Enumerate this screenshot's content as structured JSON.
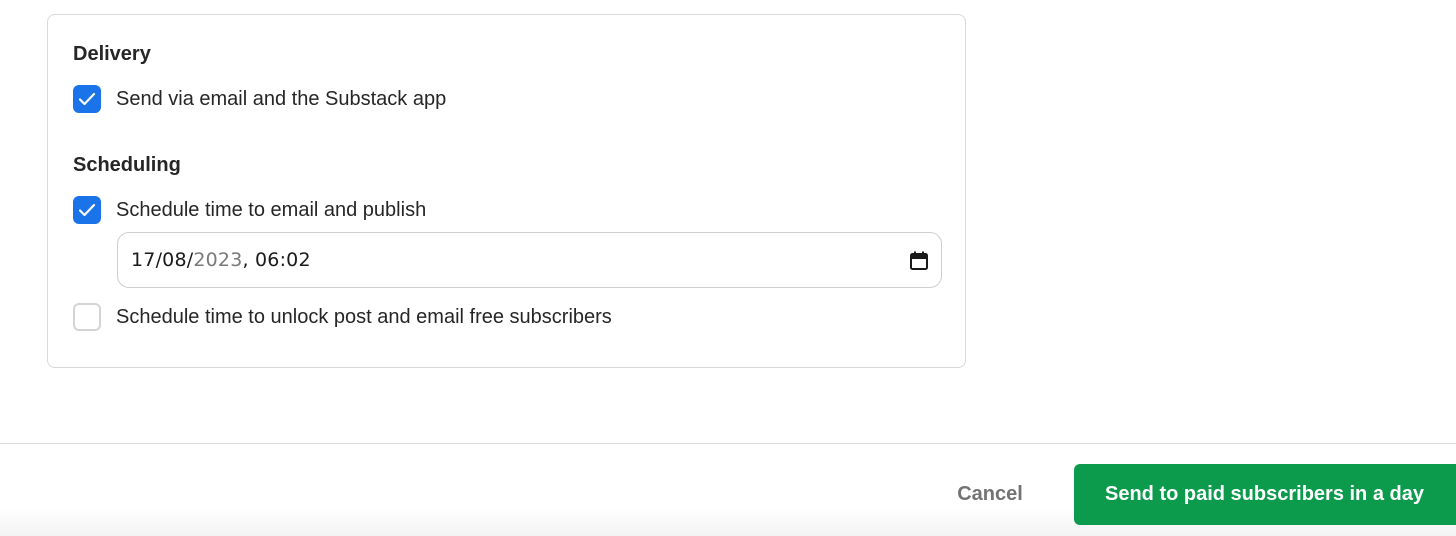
{
  "delivery": {
    "title": "Delivery",
    "options": [
      {
        "label": "Send via email and the Substack app",
        "checked": true
      }
    ]
  },
  "scheduling": {
    "title": "Scheduling",
    "schedule_publish": {
      "label": "Schedule time to email and publish",
      "checked": true
    },
    "datetime": {
      "day_month": "17/08/",
      "year": "2023",
      "time": ", 06:02"
    },
    "schedule_unlock": {
      "label": "Schedule time to unlock post and email free subscribers",
      "checked": false
    }
  },
  "footer": {
    "cancel_label": "Cancel",
    "send_label": "Send to paid subscribers in a day"
  },
  "icons": {
    "checkmark": "check-icon",
    "calendar": "calendar-icon"
  },
  "colors": {
    "checkbox_checked": "#1a73e8",
    "send_button": "#0c9b4d"
  }
}
